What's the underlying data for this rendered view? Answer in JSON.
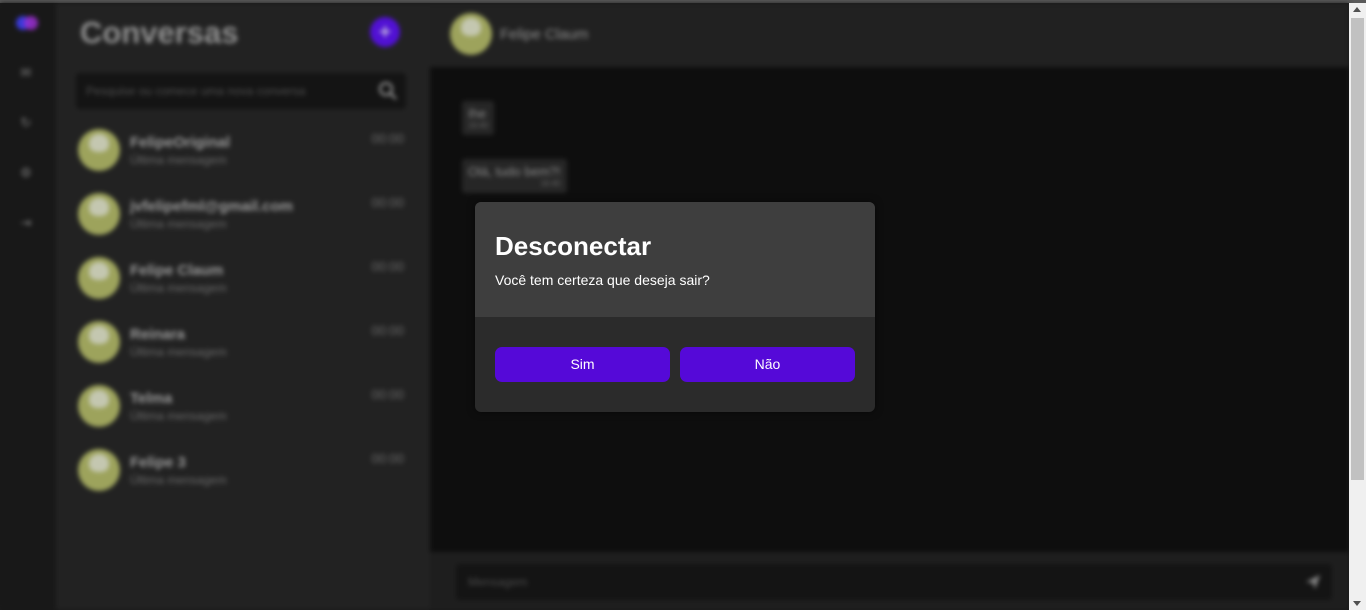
{
  "sidebar": {
    "title": "Conversas",
    "add_label": "+",
    "search_placeholder": "Pesquise ou comece uma nova conversa",
    "conversations": [
      {
        "name": "FelipeOriginal",
        "last_message": "Última mensagem",
        "time": "00:00"
      },
      {
        "name": "jvfelipefml@gmail.com",
        "last_message": "Última mensagem",
        "time": "00:00"
      },
      {
        "name": "Felipe Claum",
        "last_message": "Última mensagem",
        "time": "00:00"
      },
      {
        "name": "Reinara",
        "last_message": "Última mensagem",
        "time": "00:00"
      },
      {
        "name": "Telma",
        "last_message": "Última mensagem",
        "time": "00:00"
      },
      {
        "name": "Felipe 3",
        "last_message": "Última mensagem",
        "time": "00:00"
      }
    ]
  },
  "chat": {
    "contact_name": "Felipe Claum",
    "messages": [
      {
        "text": "Ihe",
        "time": "16:40"
      },
      {
        "text": "Olá, tudo bem?!",
        "time": "16:40"
      }
    ],
    "composer_placeholder": "Mensagem"
  },
  "modal": {
    "title": "Desconectar",
    "message": "Você tem certeza que deseja sair?",
    "confirm_label": "Sim",
    "cancel_label": "Não"
  },
  "colors": {
    "accent": "#5509d8",
    "background": "#0e0e0e",
    "panel": "#222222"
  }
}
